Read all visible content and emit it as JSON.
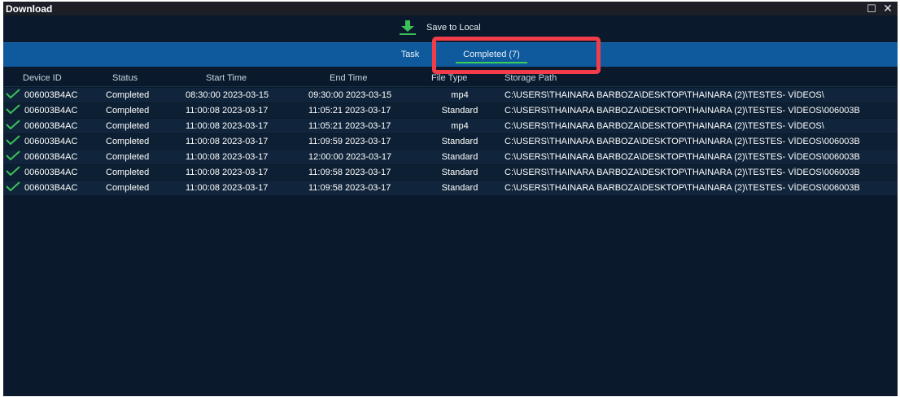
{
  "window": {
    "title": "Download",
    "maximize_glyph": "☐",
    "close_glyph": "✕"
  },
  "toolbar": {
    "save_label": "Save to Local",
    "save_icon": "download-arrow-icon"
  },
  "tabs": [
    {
      "label": "Task",
      "active": false
    },
    {
      "label": "Completed (7)",
      "active": true
    }
  ],
  "table": {
    "columns": [
      "Device ID",
      "Status",
      "Start Time",
      "End Time",
      "File Type",
      "Storage Path"
    ],
    "rows": [
      {
        "device": "006003B4AC",
        "status": "Completed",
        "start": "08:30:00 2023-03-15",
        "end": "09:30:00 2023-03-15",
        "type": "mp4",
        "path": "C:\\USERS\\THAINARA  BARBOZA\\DESKTOP\\THAINARA  (2)\\TESTES-  VÍDEOS\\"
      },
      {
        "device": "006003B4AC",
        "status": "Completed",
        "start": "11:00:08 2023-03-17",
        "end": "11:05:21 2023-03-17",
        "type": "Standard",
        "path": "C:\\USERS\\THAINARA  BARBOZA\\DESKTOP\\THAINARA  (2)\\TESTES-  VÍDEOS\\006003B"
      },
      {
        "device": "006003B4AC",
        "status": "Completed",
        "start": "11:00:08 2023-03-17",
        "end": "11:05:21 2023-03-17",
        "type": "mp4",
        "path": "C:\\USERS\\THAINARA  BARBOZA\\DESKTOP\\THAINARA  (2)\\TESTES-  VÍDEOS\\"
      },
      {
        "device": "006003B4AC",
        "status": "Completed",
        "start": "11:00:08 2023-03-17",
        "end": "11:09:59 2023-03-17",
        "type": "Standard",
        "path": "C:\\USERS\\THAINARA  BARBOZA\\DESKTOP\\THAINARA  (2)\\TESTES-  VÍDEOS\\006003B"
      },
      {
        "device": "006003B4AC",
        "status": "Completed",
        "start": "11:00:08 2023-03-17",
        "end": "12:00:00 2023-03-17",
        "type": "Standard",
        "path": "C:\\USERS\\THAINARA  BARBOZA\\DESKTOP\\THAINARA  (2)\\TESTES-  VÍDEOS\\006003B"
      },
      {
        "device": "006003B4AC",
        "status": "Completed",
        "start": "11:00:08 2023-03-17",
        "end": "11:09:58 2023-03-17",
        "type": "Standard",
        "path": "C:\\USERS\\THAINARA  BARBOZA\\DESKTOP\\THAINARA  (2)\\TESTES-  VÍDEOS\\006003B"
      },
      {
        "device": "006003B4AC",
        "status": "Completed",
        "start": "11:00:08 2023-03-17",
        "end": "11:09:58 2023-03-17",
        "type": "Standard",
        "path": "C:\\USERS\\THAINARA  BARBOZA\\DESKTOP\\THAINARA  (2)\\TESTES-  VÍDEOS\\006003B"
      }
    ]
  },
  "colors": {
    "window_bg": "#0a1a2c",
    "tab_strip": "#0f5a9c",
    "active_underline": "#39d05a",
    "highlight": "#f23c4a",
    "check": "#3cc05a"
  }
}
